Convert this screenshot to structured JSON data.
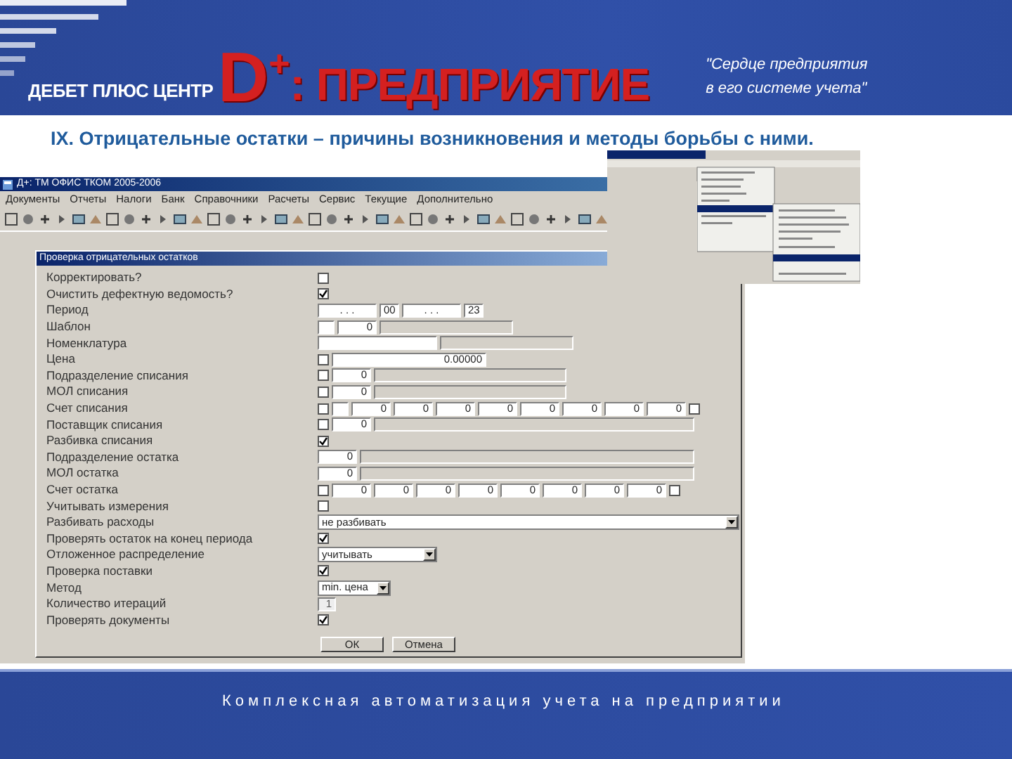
{
  "slide_header": {
    "company": "ДЕБЕТ ПЛЮС ЦЕНТР",
    "product_mark": "D",
    "product_sup": "+",
    "product_name": ": ПРЕДПРИЯТИЕ",
    "slogan": "\"Сердце предприятия\nв его системе учета\""
  },
  "heading": "IX. Отрицательные остатки – причины  возникновения и методы борьбы с ними.",
  "app_window": {
    "title": "Д+: ТМ ОФИС ТКОМ 2005-2006",
    "menu": [
      "Документы",
      "Отчеты",
      "Налоги",
      "Банк",
      "Справочники",
      "Расчеты",
      "Сервис",
      "Текущие",
      "Дополнительно"
    ],
    "dialog": {
      "title": "Проверка отрицательных остатков",
      "rows": [
        {
          "label": "Корректировать?",
          "controls": [
            {
              "kind": "check",
              "checked": false
            }
          ]
        },
        {
          "label": "Очистить дефектную ведомость?",
          "controls": [
            {
              "kind": "check",
              "checked": true
            }
          ]
        },
        {
          "label": "Период",
          "controls": [
            {
              "kind": "date",
              "value": ". . ."
            },
            {
              "kind": "code",
              "value": "00"
            },
            {
              "kind": "date",
              "value": ". . ."
            },
            {
              "kind": "code",
              "value": "23"
            }
          ]
        },
        {
          "label": "Шаблон",
          "controls": [
            {
              "kind": "blank"
            },
            {
              "kind": "num",
              "value": "0"
            },
            {
              "kind": "filler-short"
            }
          ]
        },
        {
          "label": "Номенклатура",
          "controls": [
            {
              "kind": "name"
            },
            {
              "kind": "filler-short"
            }
          ]
        },
        {
          "label": "Цена",
          "controls": [
            {
              "kind": "check",
              "checked": false
            },
            {
              "kind": "price",
              "value": "0.00000"
            }
          ]
        },
        {
          "label": "Подразделение списания",
          "controls": [
            {
              "kind": "check",
              "checked": false
            },
            {
              "kind": "num",
              "value": "0"
            },
            {
              "kind": "filler"
            }
          ]
        },
        {
          "label": "МОЛ списания",
          "controls": [
            {
              "kind": "check",
              "checked": false
            },
            {
              "kind": "num",
              "value": "0"
            },
            {
              "kind": "filler"
            }
          ]
        },
        {
          "label": "Счет списания",
          "controls": [
            {
              "kind": "check",
              "checked": false
            },
            {
              "kind": "blank"
            },
            {
              "kind": "num",
              "value": "0"
            },
            {
              "kind": "num",
              "value": "0"
            },
            {
              "kind": "num",
              "value": "0"
            },
            {
              "kind": "num",
              "value": "0"
            },
            {
              "kind": "num",
              "value": "0"
            },
            {
              "kind": "num",
              "value": "0"
            },
            {
              "kind": "num",
              "value": "0"
            },
            {
              "kind": "num",
              "value": "0"
            },
            {
              "kind": "check",
              "checked": false
            }
          ]
        },
        {
          "label": "Поставщик списания",
          "controls": [
            {
              "kind": "check",
              "checked": false
            },
            {
              "kind": "num",
              "value": "0"
            },
            {
              "kind": "filler-long"
            }
          ]
        },
        {
          "label": "Разбивка списания",
          "controls": [
            {
              "kind": "check",
              "checked": true
            }
          ]
        },
        {
          "label": "Подразделение остатка",
          "controls": [
            {
              "kind": "num",
              "value": "0"
            },
            {
              "kind": "filler-long"
            }
          ]
        },
        {
          "label": "МОЛ остатка",
          "controls": [
            {
              "kind": "num",
              "value": "0"
            },
            {
              "kind": "filler-long"
            }
          ]
        },
        {
          "label": "Счет остатка",
          "controls": [
            {
              "kind": "check",
              "checked": false
            },
            {
              "kind": "num",
              "value": "0"
            },
            {
              "kind": "num",
              "value": "0"
            },
            {
              "kind": "num",
              "value": "0"
            },
            {
              "kind": "num",
              "value": "0"
            },
            {
              "kind": "num",
              "value": "0"
            },
            {
              "kind": "num",
              "value": "0"
            },
            {
              "kind": "num",
              "value": "0"
            },
            {
              "kind": "num",
              "value": "0"
            },
            {
              "kind": "check",
              "checked": false
            }
          ]
        },
        {
          "label": "Учитывать измерения",
          "controls": [
            {
              "kind": "check",
              "checked": false
            }
          ]
        },
        {
          "label": "Разбивать расходы",
          "controls": [
            {
              "kind": "select-wide",
              "value": "не разбивать"
            }
          ]
        },
        {
          "label": "Проверять остаток на конец периода",
          "controls": [
            {
              "kind": "check",
              "checked": true
            }
          ]
        },
        {
          "label": "Отложенное распределение",
          "controls": [
            {
              "kind": "select",
              "value": "учитывать"
            }
          ]
        },
        {
          "label": "Проверка поставки",
          "controls": [
            {
              "kind": "check",
              "checked": true
            }
          ]
        },
        {
          "label": "Метод",
          "controls": [
            {
              "kind": "select-small",
              "value": "min. цена"
            }
          ]
        },
        {
          "label": "Количество итераций",
          "controls": [
            {
              "kind": "spin",
              "value": "1"
            }
          ]
        },
        {
          "label": "Проверять документы",
          "controls": [
            {
              "kind": "check",
              "checked": true
            }
          ]
        }
      ],
      "buttons": [
        "ОК",
        "Отмена"
      ]
    }
  },
  "footer": "Комплексная автоматизация учета на предприятии"
}
